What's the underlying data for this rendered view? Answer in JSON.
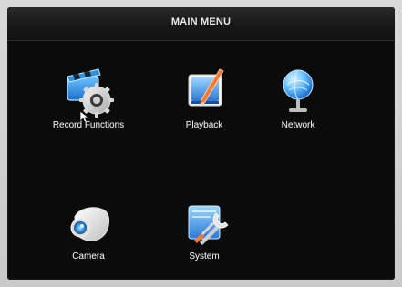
{
  "window": {
    "title": "MAIN MENU"
  },
  "menu": {
    "items": [
      {
        "label": "Record Functions",
        "icon": "record-functions-icon"
      },
      {
        "label": "Playback",
        "icon": "playback-icon"
      },
      {
        "label": "Network",
        "icon": "network-globe-icon"
      },
      {
        "label": "Camera",
        "icon": "camera-icon"
      },
      {
        "label": "System",
        "icon": "system-tools-icon"
      }
    ]
  },
  "theme": {
    "background": "#0b0b0b",
    "title_text": "#e8e8e8",
    "label_text": "#f0f0f0",
    "accent_blue": "#2f8fe0"
  }
}
